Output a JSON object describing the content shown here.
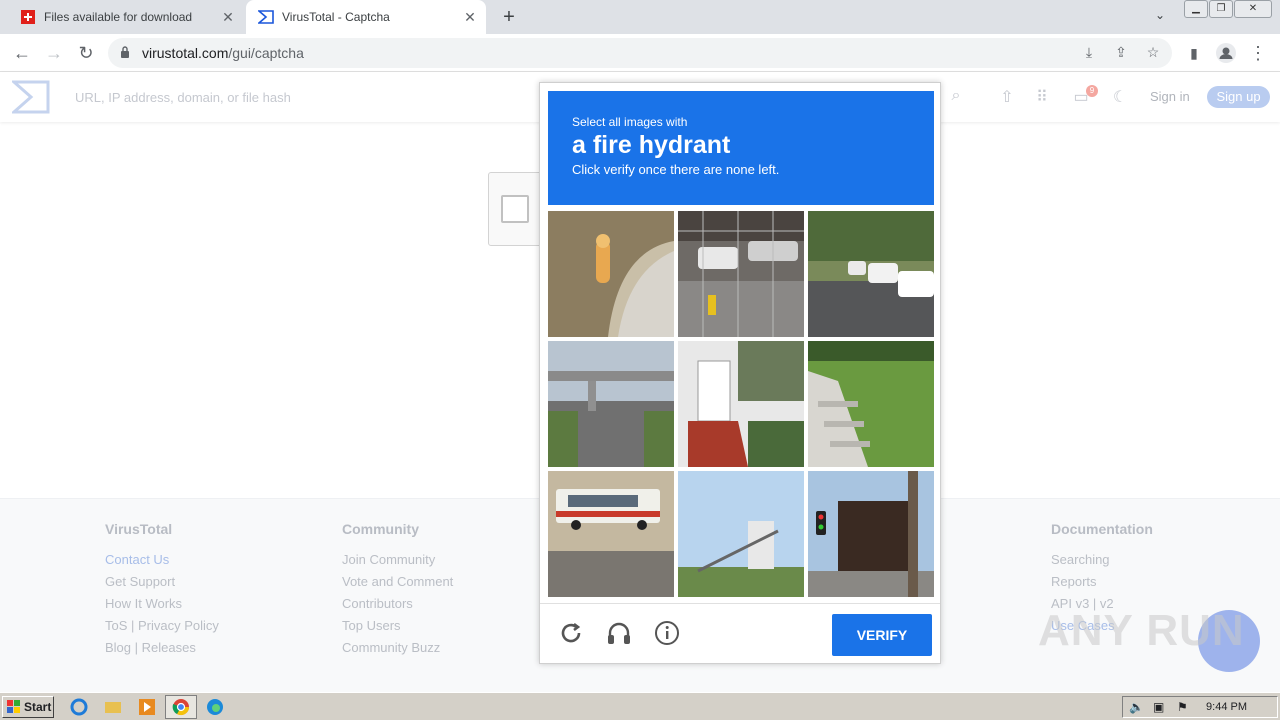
{
  "browser": {
    "tabs": [
      {
        "title": "Files available for download",
        "icon": "swiss-flag-icon"
      },
      {
        "title": "VirusTotal - Captcha",
        "icon": "virustotal-icon"
      }
    ],
    "url_host": "virustotal.com",
    "url_path": "/gui/captcha"
  },
  "vt": {
    "search_placeholder": "URL, IP address, domain, or file hash",
    "signin": "Sign in",
    "signup": "Sign up",
    "notification_count": "9"
  },
  "footer": {
    "col1": {
      "title": "VirusTotal",
      "links": [
        "Contact Us",
        "Get Support",
        "How It Works",
        "ToS | Privacy Policy",
        "Blog | Releases"
      ]
    },
    "col2": {
      "title": "Community",
      "links": [
        "Join Community",
        "Vote and Comment",
        "Contributors",
        "Top Users",
        "Community Buzz"
      ]
    },
    "col3": {
      "title": "Documentation",
      "links": [
        "Searching",
        "Reports",
        "API v3 | v2",
        "Use Cases"
      ]
    }
  },
  "captcha": {
    "line1": "Select all images with",
    "line2": "a fire hydrant",
    "line3": "Click verify once there are none left.",
    "verify": "VERIFY",
    "tiles": [
      "fire hydrant on sidewalk",
      "parking lot behind fence",
      "street with parked cars",
      "highway overpass",
      "house with red stairs",
      "grass lawn with steps",
      "school bus",
      "water tower field",
      "street corner with traffic light"
    ]
  },
  "watermark": "ANY RUN",
  "taskbar": {
    "start": "Start",
    "clock": "9:44 PM"
  },
  "colors": {
    "accent": "#1a73e8",
    "tab_bg": "#dee1e6"
  }
}
